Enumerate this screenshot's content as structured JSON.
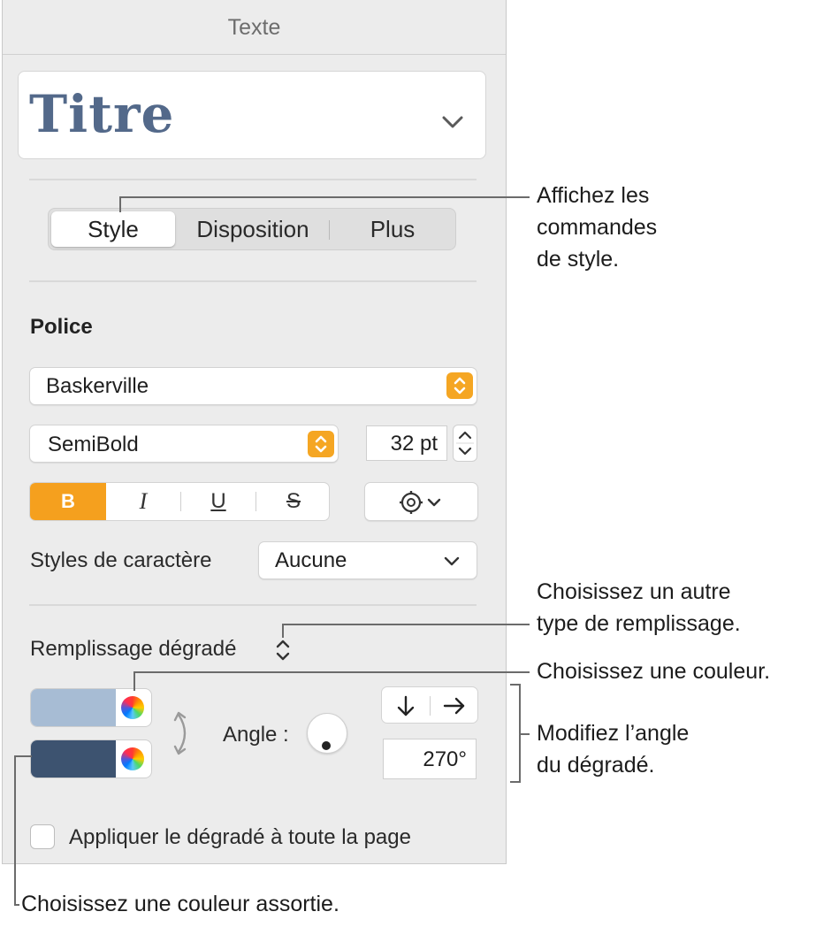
{
  "panel": {
    "title": "Texte",
    "paragraph_style": "Titre",
    "tabs": [
      "Style",
      "Disposition",
      "Plus"
    ],
    "active_tab": "Style",
    "font": {
      "section_label": "Police",
      "family": "Baskerville",
      "typeface": "SemiBold",
      "size": "32 pt",
      "format_buttons": {
        "bold": "B",
        "italic": "I",
        "underline": "U",
        "strike": "S"
      }
    },
    "char_styles": {
      "label": "Styles de caractère",
      "value": "Aucune"
    },
    "fill": {
      "type": "Remplissage dégradé",
      "color1": "#a7bcd4",
      "color2": "#3d5370",
      "angle_label": "Angle :",
      "angle_value": "270°"
    },
    "apply_page": "Appliquer le dégradé à toute la page",
    "accent_color": "#f5a01e"
  },
  "callouts": {
    "style_tab": [
      "Affichez les",
      "commandes",
      "de style."
    ],
    "fill_type": [
      "Choisissez un autre",
      "type de remplissage."
    ],
    "color": "Choisissez une couleur.",
    "angle": [
      "Modifiez l’angle",
      "du dégradé."
    ],
    "matching": "Choisissez une couleur assortie."
  }
}
